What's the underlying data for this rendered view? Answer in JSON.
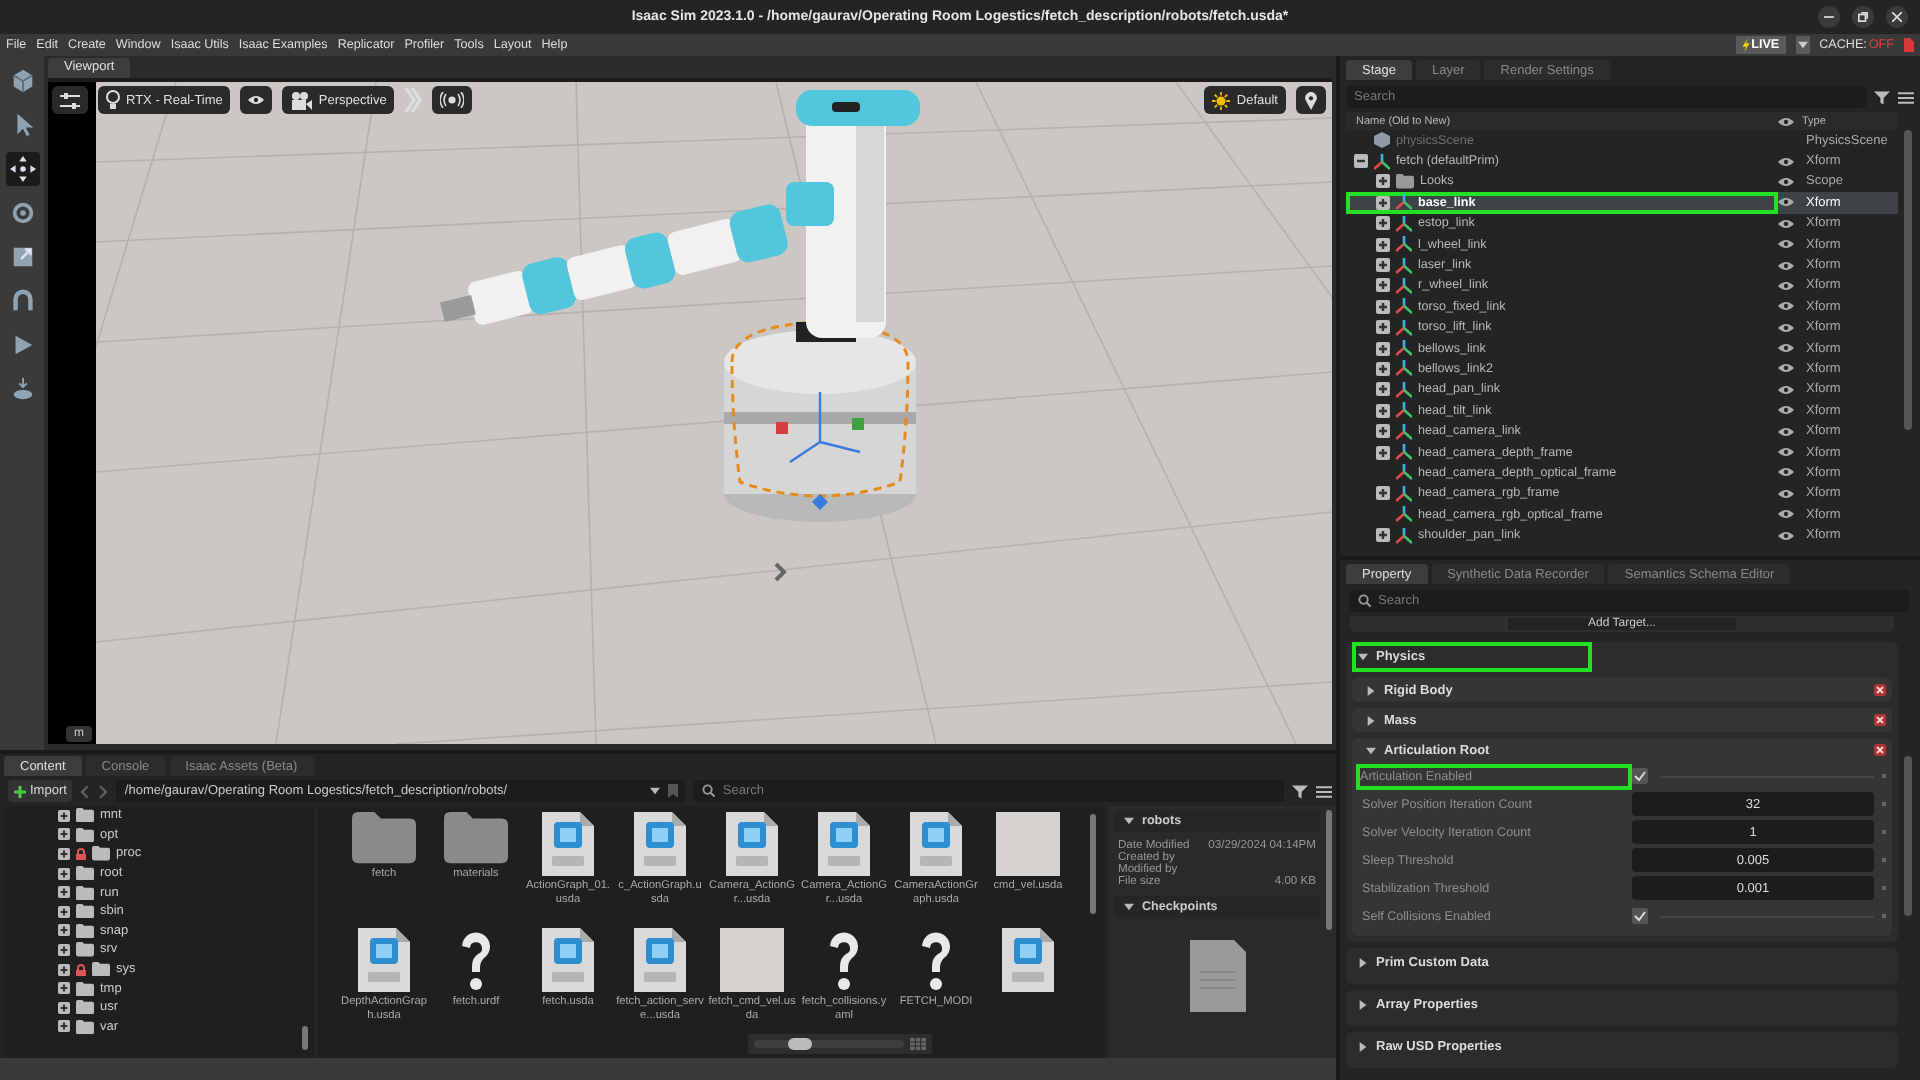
{
  "window": {
    "title": "Isaac Sim 2023.1.0 - /home/gaurav/Operating Room Logestics/fetch_description/robots/fetch.usda*"
  },
  "menu": [
    "File",
    "Edit",
    "Create",
    "Window",
    "Isaac Utils",
    "Isaac Examples",
    "Replicator",
    "Profiler",
    "Tools",
    "Layout",
    "Help"
  ],
  "status": {
    "live": "LIVE",
    "cache_label": "CACHE:",
    "cache_value": "OFF"
  },
  "tools": [
    {
      "kind": "cube",
      "selected": false
    },
    {
      "kind": "pointer",
      "selected": false
    },
    {
      "kind": "move",
      "selected": true
    },
    {
      "kind": "rotate",
      "selected": false
    },
    {
      "kind": "scale",
      "selected": false
    },
    {
      "kind": "snap",
      "selected": false
    },
    {
      "kind": "play",
      "selected": false
    },
    {
      "kind": "drop",
      "selected": false
    }
  ],
  "viewport": {
    "tab": "Viewport",
    "renderer": "RTX - Real-Time",
    "camera": "Perspective",
    "lighting": "Default",
    "corner_button": "m"
  },
  "stage": {
    "tabs": [
      {
        "label": "Stage",
        "selected": true
      },
      {
        "label": "Layer",
        "selected": false
      },
      {
        "label": "Render Settings",
        "selected": false
      }
    ],
    "search": {
      "placeholder": "Search"
    },
    "columns": [
      "Name (Old to New)",
      "Type"
    ],
    "rows": [
      {
        "name": "physicsScene",
        "type": "PhysicsScene",
        "kind": "scene",
        "expandable": false,
        "visible": false,
        "selected": false,
        "highlighted": false
      },
      {
        "name": "fetch (defaultPrim)",
        "type": "Xform",
        "kind": "xform",
        "expandable": true,
        "expanded": true,
        "visible": true,
        "selected": false,
        "highlighted": false,
        "children": [
          {
            "name": "Looks",
            "type": "Scope",
            "kind": "folder",
            "expandable": true,
            "expanded": false,
            "visible": true,
            "selected": false,
            "highlighted": false
          },
          {
            "name": "base_link",
            "type": "Xform",
            "kind": "xform",
            "expandable": true,
            "expanded": false,
            "visible": true,
            "selected": true,
            "highlighted": true
          },
          {
            "name": "estop_link",
            "type": "Xform",
            "kind": "xform",
            "expandable": true,
            "expanded": false,
            "visible": true,
            "selected": false,
            "highlighted": false
          },
          {
            "name": "l_wheel_link",
            "type": "Xform",
            "kind": "xform",
            "expandable": true,
            "expanded": false,
            "visible": true,
            "selected": false,
            "highlighted": false
          },
          {
            "name": "laser_link",
            "type": "Xform",
            "kind": "xform",
            "expandable": true,
            "expanded": false,
            "visible": true,
            "selected": false,
            "highlighted": false
          },
          {
            "name": "r_wheel_link",
            "type": "Xform",
            "kind": "xform",
            "expandable": true,
            "expanded": false,
            "visible": true,
            "selected": false,
            "highlighted": false
          },
          {
            "name": "torso_fixed_link",
            "type": "Xform",
            "kind": "xform",
            "expandable": true,
            "expanded": false,
            "visible": true,
            "selected": false,
            "highlighted": false
          },
          {
            "name": "torso_lift_link",
            "type": "Xform",
            "kind": "xform",
            "expandable": true,
            "expanded": false,
            "visible": true,
            "selected": false,
            "highlighted": false
          },
          {
            "name": "bellows_link",
            "type": "Xform",
            "kind": "xform",
            "expandable": true,
            "expanded": false,
            "visible": true,
            "selected": false,
            "highlighted": false
          },
          {
            "name": "bellows_link2",
            "type": "Xform",
            "kind": "xform",
            "expandable": true,
            "expanded": false,
            "visible": true,
            "selected": false,
            "highlighted": false
          },
          {
            "name": "head_pan_link",
            "type": "Xform",
            "kind": "xform",
            "expandable": true,
            "expanded": false,
            "visible": true,
            "selected": false,
            "highlighted": false
          },
          {
            "name": "head_tilt_link",
            "type": "Xform",
            "kind": "xform",
            "expandable": true,
            "expanded": false,
            "visible": true,
            "selected": false,
            "highlighted": false
          },
          {
            "name": "head_camera_link",
            "type": "Xform",
            "kind": "xform",
            "expandable": true,
            "expanded": false,
            "visible": true,
            "selected": false,
            "highlighted": false
          },
          {
            "name": "head_camera_depth_frame",
            "type": "Xform",
            "kind": "xform",
            "expandable": true,
            "expanded": false,
            "visible": true,
            "selected": false,
            "highlighted": false
          },
          {
            "name": "head_camera_depth_optical_frame",
            "type": "Xform",
            "kind": "xform",
            "expandable": false,
            "visible": true,
            "selected": false,
            "highlighted": false
          },
          {
            "name": "head_camera_rgb_frame",
            "type": "Xform",
            "kind": "xform",
            "expandable": true,
            "expanded": false,
            "visible": true,
            "selected": false,
            "highlighted": false
          },
          {
            "name": "head_camera_rgb_optical_frame",
            "type": "Xform",
            "kind": "xform",
            "expandable": false,
            "visible": true,
            "selected": false,
            "highlighted": false
          },
          {
            "name": "shoulder_pan_link",
            "type": "Xform",
            "kind": "xform",
            "expandable": true,
            "expanded": false,
            "visible": true,
            "selected": false,
            "highlighted": false
          }
        ]
      }
    ]
  },
  "property": {
    "tabs": [
      {
        "label": "Property",
        "selected": true
      },
      {
        "label": "Synthetic Data Recorder",
        "selected": false
      },
      {
        "label": "Semantics Schema Editor",
        "selected": false
      }
    ],
    "search": {
      "placeholder": "Search"
    },
    "add_target": "Add Target...",
    "sections": [
      {
        "title": "Physics",
        "expanded": true,
        "highlighted": true,
        "children": [
          {
            "title": "Rigid Body",
            "expanded": false,
            "removable": true
          },
          {
            "title": "Mass",
            "expanded": false,
            "removable": true
          },
          {
            "title": "Articulation Root",
            "expanded": true,
            "removable": true,
            "fields": [
              {
                "kind": "checkbox",
                "label": "Articulation Enabled",
                "checked": true,
                "highlighted": true
              },
              {
                "kind": "number",
                "label": "Solver Position Iteration Count",
                "value": "32",
                "highlighted": false
              },
              {
                "kind": "number",
                "label": "Solver Velocity Iteration Count",
                "value": "1",
                "highlighted": false
              },
              {
                "kind": "number",
                "label": "Sleep Threshold",
                "value": "0.005",
                "highlighted": false
              },
              {
                "kind": "number",
                "label": "Stabilization Threshold",
                "value": "0.001",
                "highlighted": false
              },
              {
                "kind": "checkbox",
                "label": "Self Collisions Enabled",
                "checked": true,
                "highlighted": false
              }
            ]
          }
        ]
      },
      {
        "title": "Prim Custom Data",
        "expanded": false,
        "highlighted": false
      },
      {
        "title": "Array Properties",
        "expanded": false,
        "highlighted": false
      },
      {
        "title": "Raw USD Properties",
        "expanded": false,
        "highlighted": false
      }
    ]
  },
  "content": {
    "tabs": [
      {
        "label": "Content",
        "selected": true
      },
      {
        "label": "Console",
        "selected": false
      },
      {
        "label": "Isaac Assets (Beta)",
        "selected": false
      }
    ],
    "import": "Import",
    "path": "/home/gaurav/Operating Room Logestics/fetch_description/robots/",
    "search": {
      "placeholder": "Search"
    },
    "tree": [
      {
        "name": "mnt",
        "locked": false
      },
      {
        "name": "opt",
        "locked": false
      },
      {
        "name": "proc",
        "locked": true
      },
      {
        "name": "root",
        "locked": false
      },
      {
        "name": "run",
        "locked": false
      },
      {
        "name": "sbin",
        "locked": false
      },
      {
        "name": "snap",
        "locked": false
      },
      {
        "name": "srv",
        "locked": false
      },
      {
        "name": "sys",
        "locked": true
      },
      {
        "name": "tmp",
        "locked": false
      },
      {
        "name": "usr",
        "locked": false
      },
      {
        "name": "var",
        "locked": false
      }
    ],
    "files": [
      {
        "name": "fetch",
        "kind": "folder"
      },
      {
        "name": "materials",
        "kind": "folder"
      },
      {
        "name": "ActionGraph_01.usda",
        "kind": "usd"
      },
      {
        "name": "c_ActionGraph.usda",
        "kind": "usd"
      },
      {
        "name": "Camera_ActionGr...usda",
        "kind": "usd"
      },
      {
        "name": "Camera_ActionGr...usda",
        "kind": "usd"
      },
      {
        "name": "CameraActionGraph.usda",
        "kind": "usd"
      },
      {
        "name": "cmd_vel.usda",
        "kind": "thumbnail"
      },
      {
        "name": "DepthActionGraph.usda",
        "kind": "usd"
      },
      {
        "name": "fetch.urdf",
        "kind": "unknown"
      },
      {
        "name": "fetch.usda",
        "kind": "usd"
      },
      {
        "name": "fetch_action_serve...usda",
        "kind": "usd"
      },
      {
        "name": "fetch_cmd_vel.usda",
        "kind": "thumbnail"
      },
      {
        "name": "fetch_collisions.yaml",
        "kind": "unknown"
      },
      {
        "name": "FETCH_MODI",
        "kind": "unknown"
      },
      {
        "kind": "usd"
      }
    ],
    "zoom": {
      "level": 0.3
    },
    "info": {
      "title": "robots",
      "rows": [
        {
          "label": "Date Modified",
          "value": "03/29/2024 04:14PM"
        },
        {
          "label": "Created by"
        },
        {
          "label": "Modified by"
        },
        {
          "label": "File size",
          "value": "4.00 KB"
        }
      ],
      "checkpoints": "Checkpoints"
    }
  }
}
